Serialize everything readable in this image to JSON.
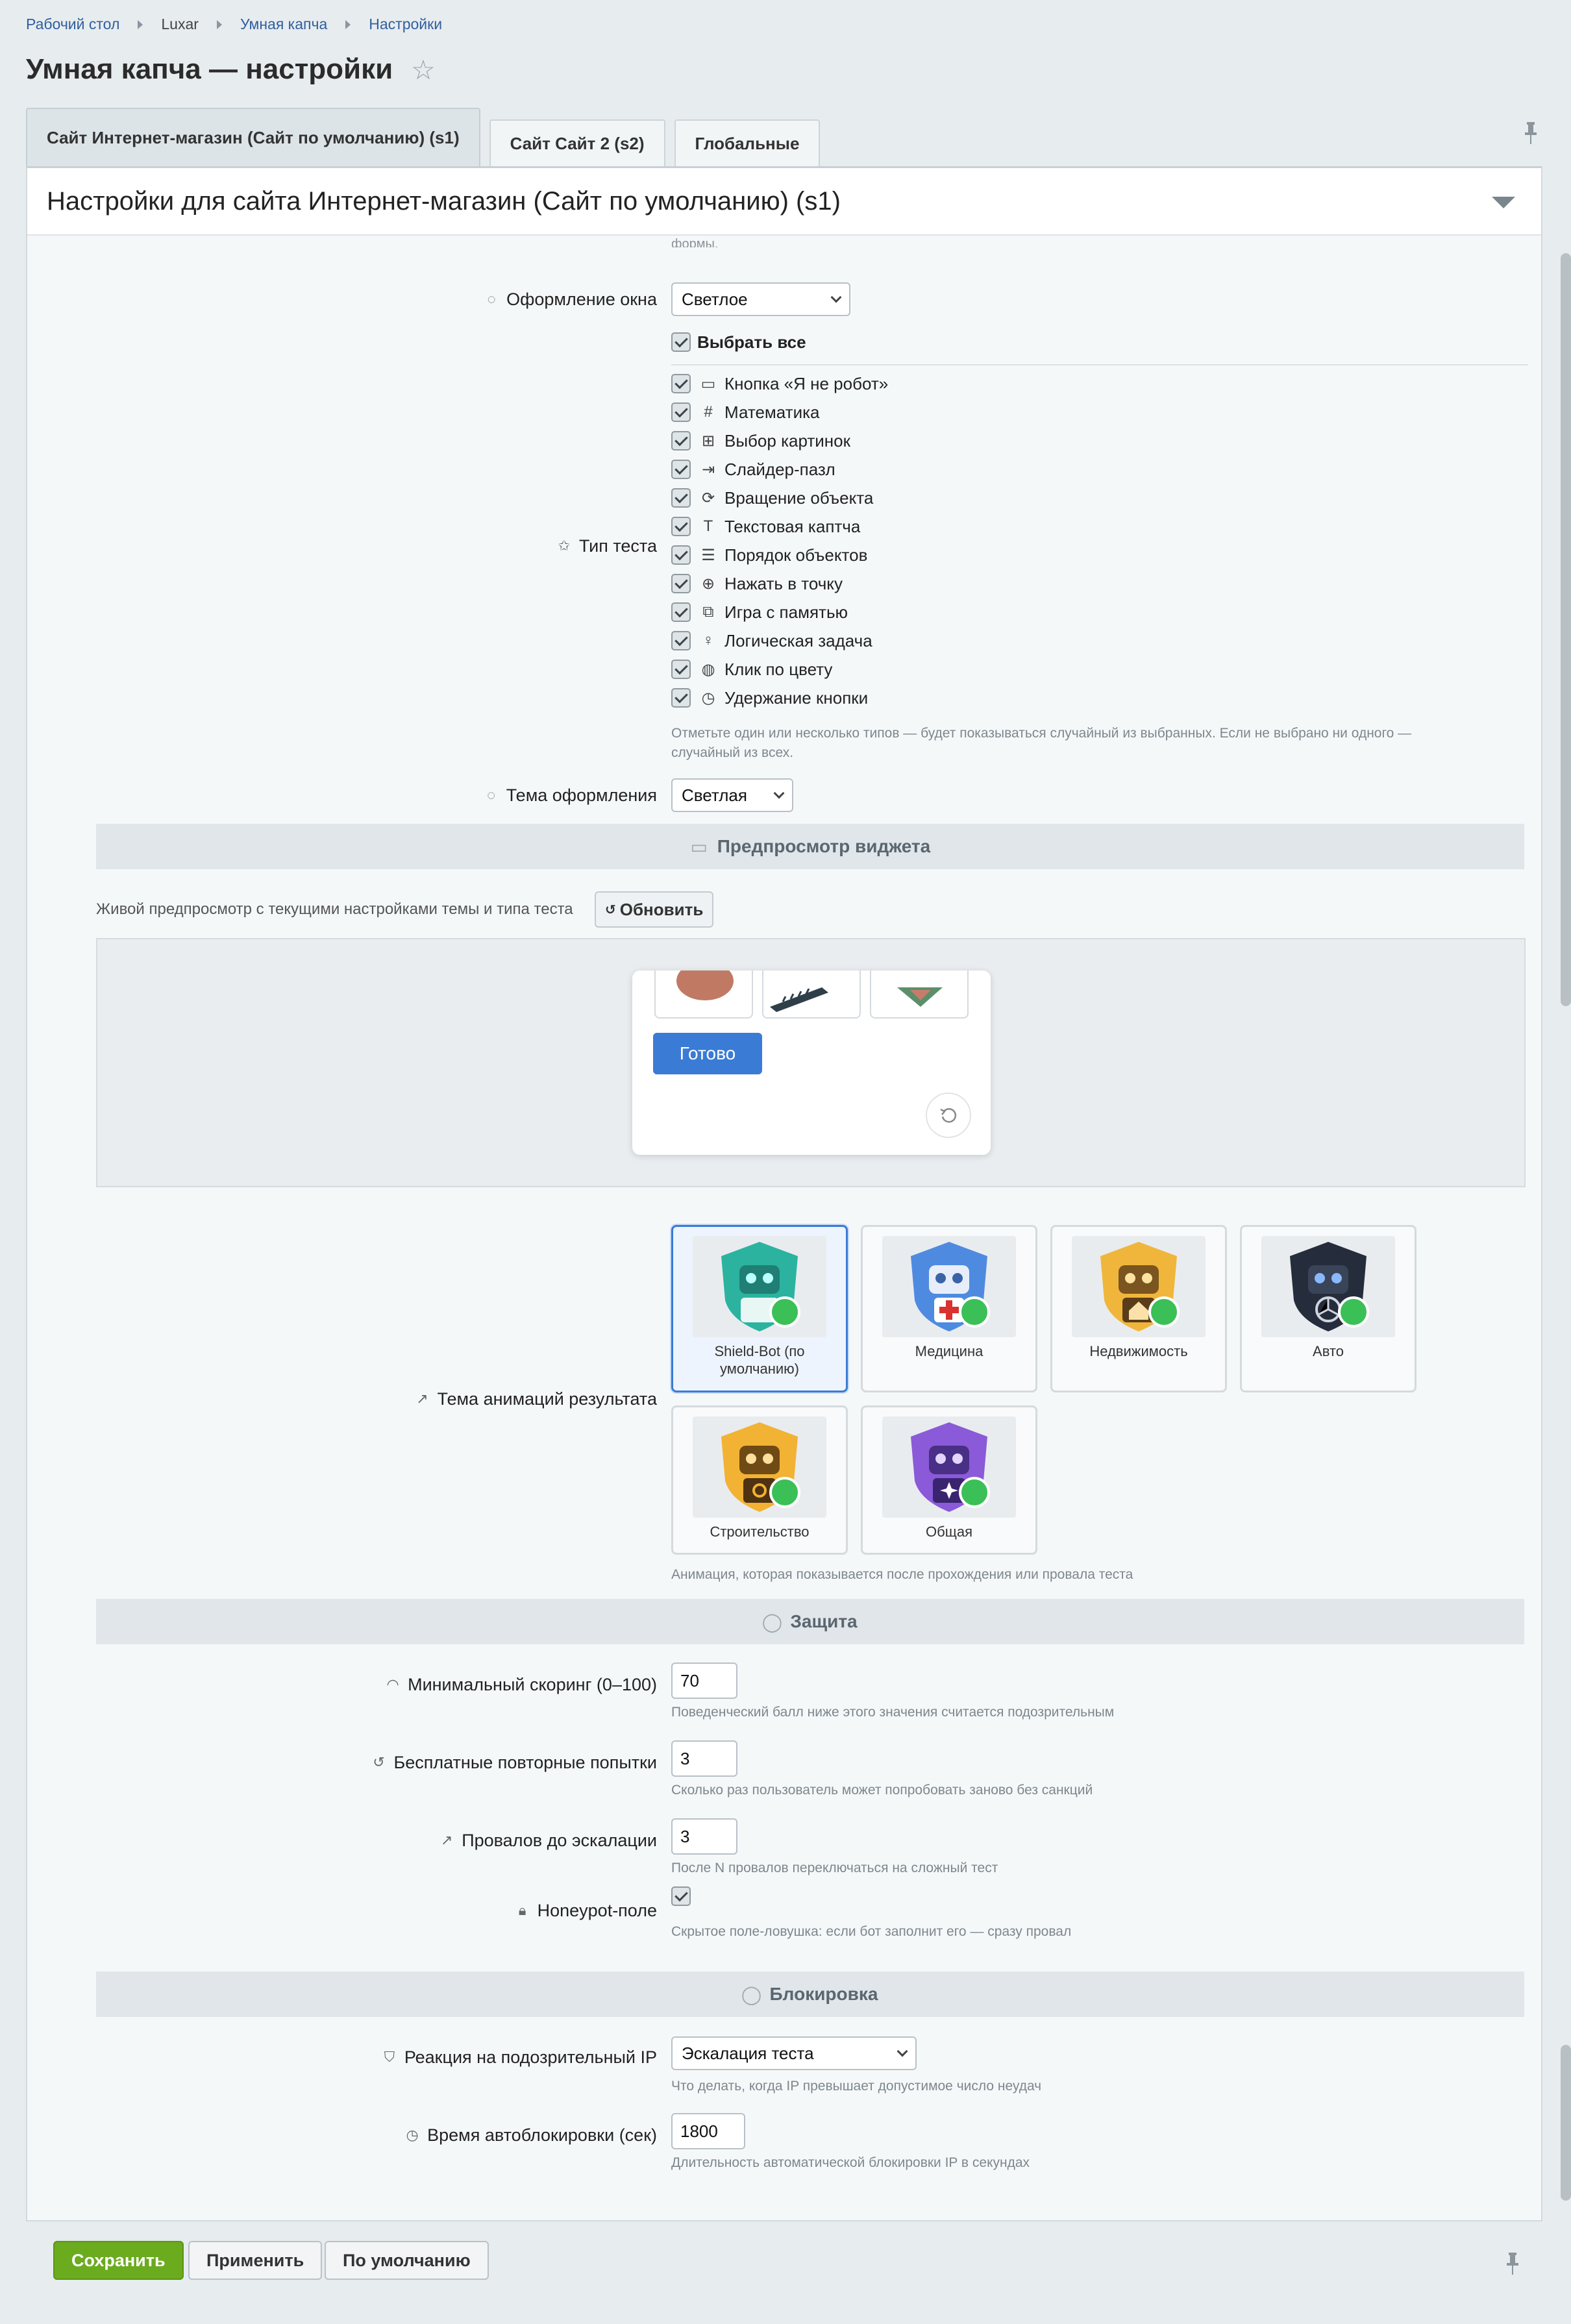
{
  "breadcrumb": [
    "Рабочий стол",
    "Luxar",
    "Умная капча",
    "Настройки"
  ],
  "page_title": "Умная капча — настройки",
  "tabs": [
    "Сайт Интернет-магазин (Сайт по умолчанию) (s1)",
    "Сайт Сайт 2 (s2)",
    "Глобальные"
  ],
  "panel_title": "Настройки для сайта Интернет-магазин (Сайт по умолчанию) (s1)",
  "top_note": "формы.",
  "window_style": {
    "label": "Оформление окна",
    "value": "Светлое"
  },
  "test_type": {
    "label": "Тип теста",
    "select_all": "Выбрать все",
    "items": [
      "Кнопка «Я не робот»",
      "Математика",
      "Выбор картинок",
      "Слайдер-пазл",
      "Вращение объекта",
      "Текстовая каптча",
      "Порядок объектов",
      "Нажать в точку",
      "Игра с памятью",
      "Логическая задача",
      "Клик по цвету",
      "Удержание кнопки"
    ],
    "help_line1": "Отметьте один или несколько типов — будет показываться случайный из выбранных. Если не выбрано ни одного —",
    "help_line2": "случайный из всех."
  },
  "theme": {
    "label": "Тема оформления",
    "value": "Светлая"
  },
  "preview_section": "Предпросмотр виджета",
  "preview_text": "Живой предпросмотр с текущими настройками темы и типа теста",
  "refresh_button": "Обновить",
  "done_button": "Готово",
  "anim_theme": {
    "label": "Тема анимаций результата",
    "cards": [
      {
        "line1": "Shield-Bot (по",
        "line2": "умолчанию)"
      },
      {
        "line1": "Медицина",
        "line2": ""
      },
      {
        "line1": "Недвижимость",
        "line2": ""
      },
      {
        "line1": "Авто",
        "line2": ""
      },
      {
        "line1": "Строительство",
        "line2": ""
      },
      {
        "line1": "Общая",
        "line2": ""
      }
    ],
    "help": "Анимация, которая показывается после прохождения или провала теста"
  },
  "protection_section": "Защита",
  "min_score": {
    "label": "Минимальный скоринг (0–100)",
    "value": "70",
    "help": "Поведенческий балл ниже этого значения считается подозрительным"
  },
  "free_retries": {
    "label": "Бесплатные повторные попытки",
    "value": "3",
    "help": "Сколько раз пользователь может попробовать заново без санкций"
  },
  "fails_escalation": {
    "label": "Провалов до эскалации",
    "value": "3",
    "help": "После N провалов переключаться на сложный тест"
  },
  "honeypot": {
    "label": "Honeypot-поле",
    "help": "Скрытое поле-ловушка: если бот заполнит его — сразу провал"
  },
  "block_section": "Блокировка",
  "suspicious_ip": {
    "label": "Реакция на подозрительный IP",
    "value": "Эскалация теста",
    "help": "Что делать, когда IP превышает допустимое число неудач"
  },
  "autoblock": {
    "label": "Время автоблокировки (сек)",
    "value": "1800",
    "help": "Длительность автоматической блокировки IP в секундах"
  },
  "footer": {
    "save": "Сохранить",
    "apply": "Применить",
    "default": "По умолчанию"
  },
  "colors": {
    "accent": "#3a7bd5",
    "save": "#6bab1e"
  }
}
